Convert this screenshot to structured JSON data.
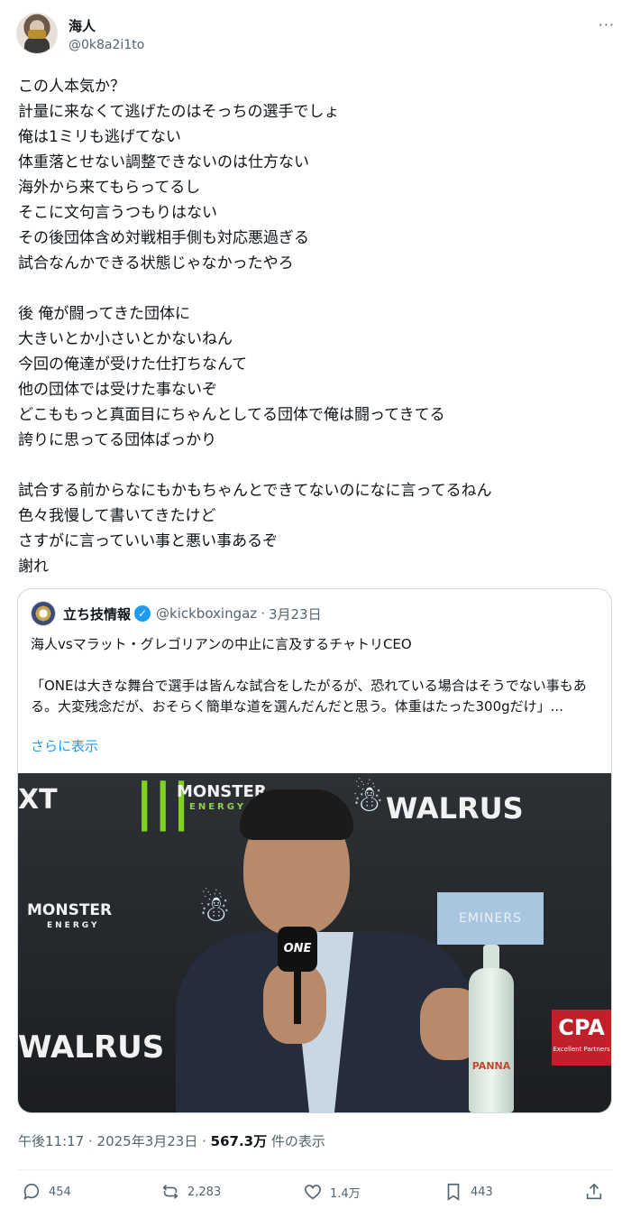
{
  "user": {
    "name": "海人",
    "handle": "@0k8a2i1to"
  },
  "more_label": "···",
  "tweet": {
    "lines": "この人本気か？\n計量に来なくて逃げたのはそっちの選手でしょ\n俺は1ミリも逃げてない\n体重落とせない調整できないのは仕方ない\n海外から来てもらってるし\nそこに文句言うつもりはない\nその後団体含め対戦相手側も対応悪過ぎる\n試合なんかできる状態じゃなかったやろ\n\n後 俺が闘ってきた団体に\n大きいとか小さいとかないねん\n今回の俺達が受けた仕打ちなんて\n他の団体では受けた事ないぞ\nどこももっと真面目にちゃんとしてる団体で俺は闘ってきてる\n誇りに思ってる団体ばっかり\n\n試合する前からなにもかもちゃんとできてないのになに言ってるねん\n色々我慢して書いてきたけど\nさすがに言っていい事と悪い事あるぞ\n謝れ"
  },
  "quote": {
    "name": "立ち技情報",
    "handle": "@kickboxingaz",
    "sep": "·",
    "date": "3月23日",
    "text": "海人vsマラット・グレゴリアンの中止に言及するチャトリCEO\n\n「ONEは大きな舞台で選手は皆んな試合をしたがるが、恐れている場合はそうでない事もある。大変残念だが、おそらく簡単な道を選んだんだと思う。体重はたった300gだけ」...",
    "show_more": "さらに表示",
    "image_texts": {
      "monster": "MONSTER",
      "energy": "ENERGY",
      "walrus": "WALRUS",
      "xt": "XT",
      "eminers": "EMINERS",
      "one": "ONE",
      "cpa": "CPA",
      "cpa_sub": "Excellent Partners",
      "panna": "PANNA"
    }
  },
  "meta": {
    "time": "午後11:17 · 2025年3月23日 · ",
    "views": "567.3万",
    "views_suffix": " 件の表示"
  },
  "actions": {
    "replies": "454",
    "reposts": "2,283",
    "likes": "1.4万",
    "bookmarks": "443"
  },
  "colors": {
    "accent": "#1d9bf0",
    "text": "#0f1419",
    "muted": "#536471",
    "border": "#cfd9de"
  }
}
